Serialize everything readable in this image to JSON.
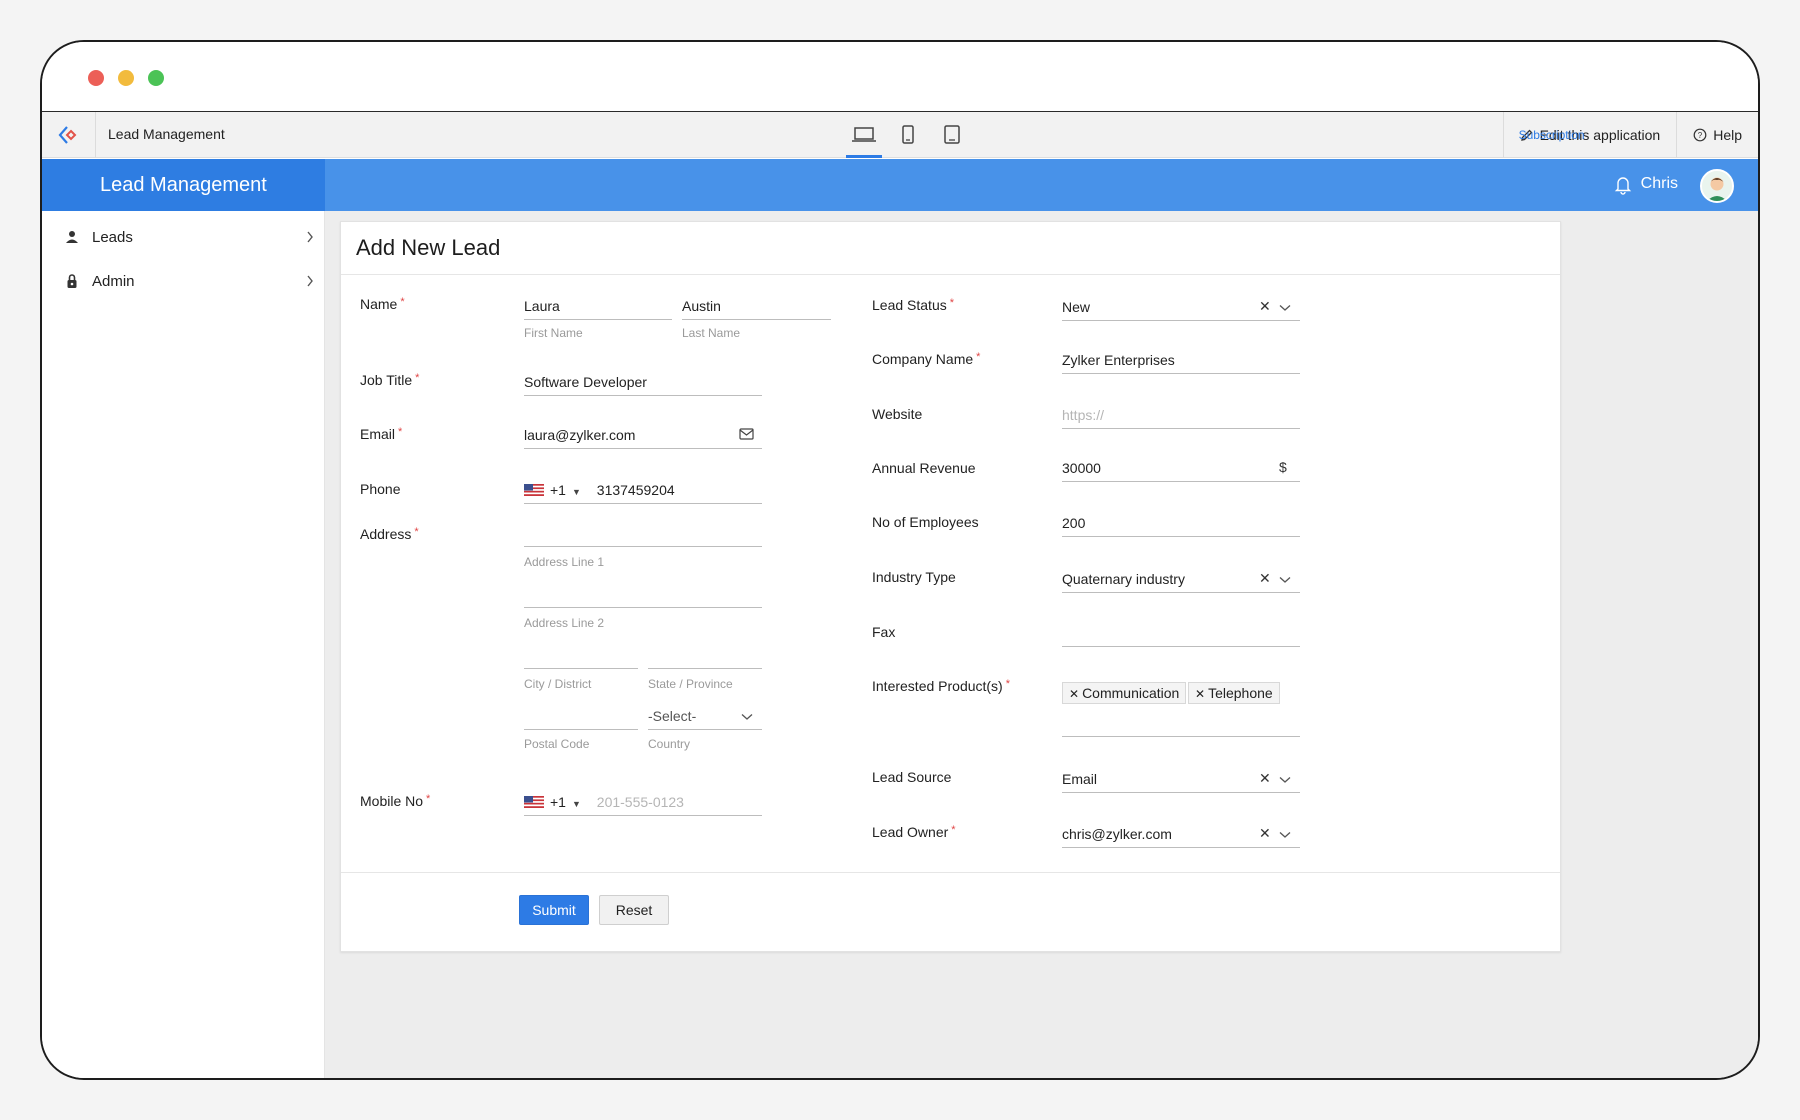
{
  "appbar": {
    "app_name": "Lead Management",
    "subscription": "Subscription",
    "edit_app": "Edit this application",
    "help": "Help"
  },
  "sidebar": {
    "header": "Lead Management",
    "items": [
      {
        "label": "Leads",
        "icon": "person-icon"
      },
      {
        "label": "Admin",
        "icon": "lock-icon"
      }
    ]
  },
  "header": {
    "user_name": "Chris"
  },
  "form": {
    "title": "Add New Lead",
    "name_label": "Name",
    "first_name": "Laura",
    "first_name_sub": "First Name",
    "last_name": "Austin",
    "last_name_sub": "Last Name",
    "job_title_label": "Job Title",
    "job_title": "Software Developer",
    "email_label": "Email",
    "email": "laura@zylker.com",
    "phone_label": "Phone",
    "phone_code": "+1",
    "phone": "3137459204",
    "address_label": "Address",
    "address_line1_sub": "Address Line 1",
    "address_line2_sub": "Address Line 2",
    "city_sub": "City / District",
    "state_sub": "State / Province",
    "country_value": "-Select-",
    "postal_sub": "Postal Code",
    "country_sub": "Country",
    "mobile_label": "Mobile No",
    "mobile_code": "+1",
    "mobile_placeholder": "201-555-0123",
    "lead_status_label": "Lead Status",
    "lead_status": "New",
    "company_label": "Company Name",
    "company": "Zylker Enterprises",
    "website_label": "Website",
    "website_placeholder": "https://",
    "revenue_label": "Annual Revenue",
    "revenue": "30000",
    "revenue_currency": "$",
    "employees_label": "No of Employees",
    "employees": "200",
    "industry_label": "Industry Type",
    "industry": "Quaternary industry",
    "fax_label": "Fax",
    "products_label": "Interested Product(s)",
    "products": [
      "Communication",
      "Telephone"
    ],
    "source_label": "Lead Source",
    "source": "Email",
    "owner_label": "Lead Owner",
    "owner": "chris@zylker.com",
    "submit": "Submit",
    "reset": "Reset"
  },
  "colors": {
    "accent": "#2e7de2",
    "band": "#4892e9",
    "required": "#e04545"
  }
}
